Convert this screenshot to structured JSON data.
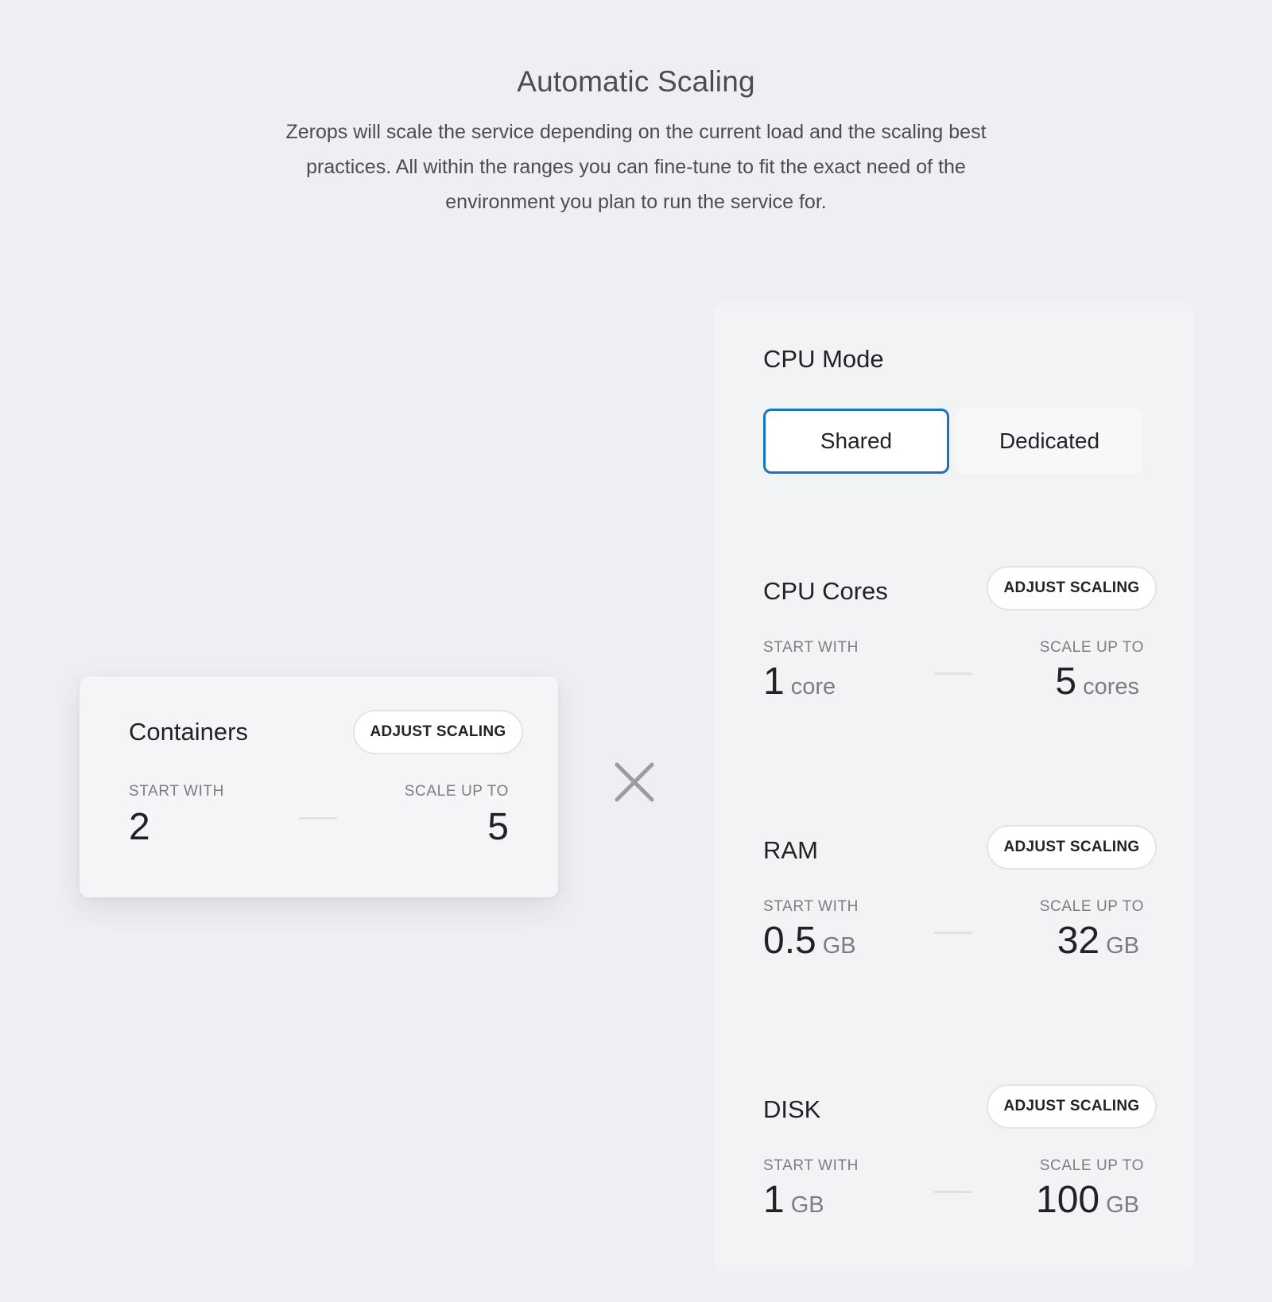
{
  "header": {
    "title": "Automatic Scaling",
    "description": "Zerops will scale the service depending on the current load and the scaling best practices. All within the ranges you can fine-tune to fit the exact need of the environment you plan to run the service for."
  },
  "containers": {
    "title": "Containers",
    "adjust_label": "ADJUST SCALING",
    "start_label": "START WITH",
    "start_value": "2",
    "max_label": "SCALE UP TO",
    "max_value": "5"
  },
  "multiply_icon": "times-icon",
  "cpu_mode": {
    "title": "CPU Mode",
    "options": [
      {
        "label": "Shared",
        "selected": true
      },
      {
        "label": "Dedicated",
        "selected": false
      }
    ],
    "accent_color": "#1a74bd"
  },
  "resources": [
    {
      "title": "CPU Cores",
      "adjust_label": "ADJUST SCALING",
      "start_label": "START WITH",
      "start_value": "1",
      "start_unit": "core",
      "max_label": "SCALE UP TO",
      "max_value": "5",
      "max_unit": "cores"
    },
    {
      "title": "RAM",
      "adjust_label": "ADJUST SCALING",
      "start_label": "START WITH",
      "start_value": "0.5",
      "start_unit": "GB",
      "max_label": "SCALE UP TO",
      "max_value": "32",
      "max_unit": "GB"
    },
    {
      "title": "DISK",
      "adjust_label": "ADJUST SCALING",
      "start_label": "START WITH",
      "start_value": "1",
      "start_unit": "GB",
      "max_label": "SCALE UP TO",
      "max_value": "100",
      "max_unit": "GB"
    }
  ]
}
